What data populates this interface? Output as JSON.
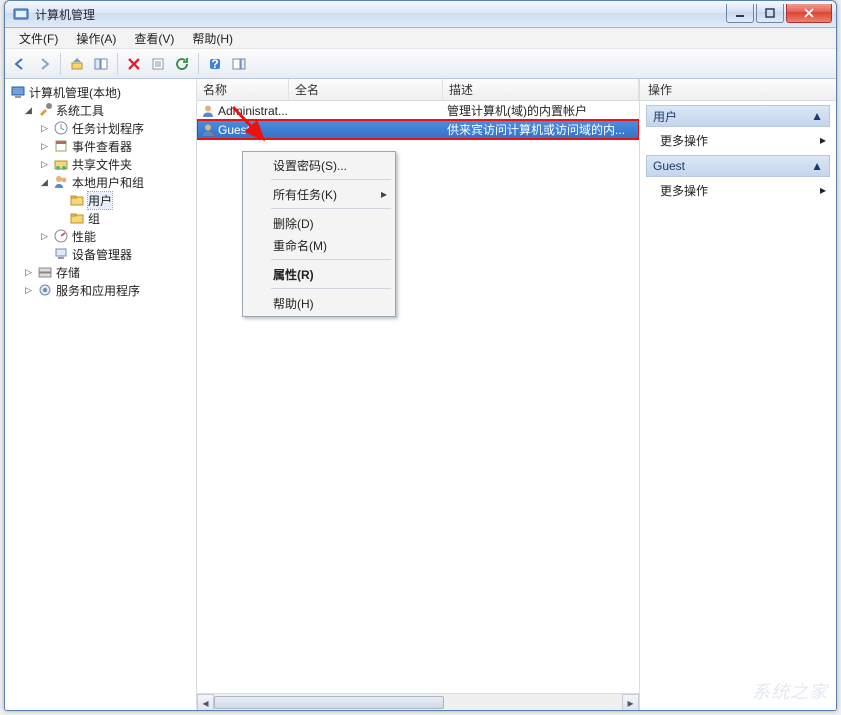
{
  "window": {
    "title": "计算机管理"
  },
  "menubar": {
    "file": "文件(F)",
    "action": "操作(A)",
    "view": "查看(V)",
    "help": "帮助(H)"
  },
  "tree": {
    "root": "计算机管理(本地)",
    "sys": "系统工具",
    "task": "任务计划程序",
    "event": "事件查看器",
    "share": "共享文件夹",
    "lug": "本地用户和组",
    "users": "用户",
    "groups": "组",
    "perf": "性能",
    "devmgr": "设备管理器",
    "storage": "存储",
    "services": "服务和应用程序"
  },
  "list": {
    "headers": {
      "name": "名称",
      "fullname": "全名",
      "desc": "描述"
    },
    "rows": [
      {
        "name": "Administrat...",
        "fullname": "",
        "desc": "管理计算机(域)的内置帐户"
      },
      {
        "name": "Guest",
        "fullname": "",
        "desc": "供来宾访问计算机或访问域的内..."
      }
    ]
  },
  "ctx": {
    "setpwd": "设置密码(S)...",
    "alltasks": "所有任务(K)",
    "delete": "删除(D)",
    "rename": "重命名(M)",
    "props": "属性(R)",
    "help": "帮助(H)"
  },
  "actions": {
    "header": "操作",
    "group1": "用户",
    "more1": "更多操作",
    "group2": "Guest",
    "more2": "更多操作"
  }
}
